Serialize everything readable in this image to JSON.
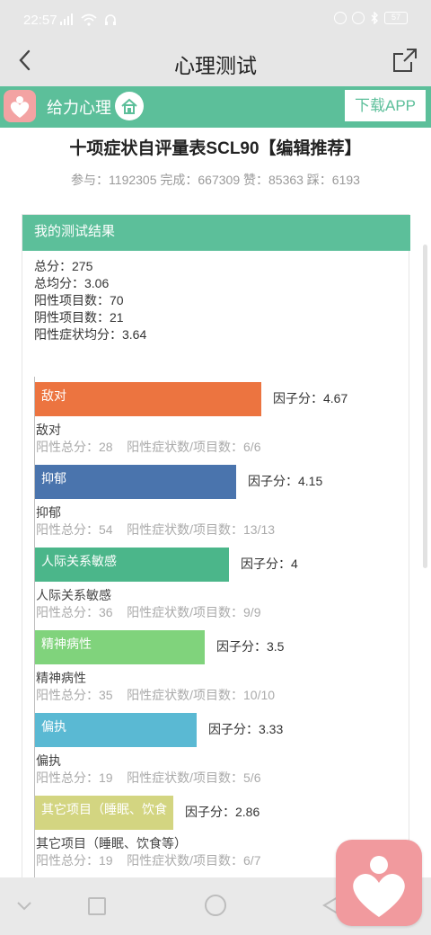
{
  "status_bar": {
    "time": "22:57",
    "battery": "57"
  },
  "header": {
    "title": "心理测试"
  },
  "app_banner": {
    "name": "给力心理",
    "download_label": "下载APP"
  },
  "test": {
    "title": "十项症状自评量表SCL90【编辑推荐】",
    "stats_line": "参与：1192305 完成：667309 赞：85363 踩：6193"
  },
  "result": {
    "header": "我的测试结果",
    "summary": [
      "总分：275",
      "总均分：3.06",
      "阳性项目数：70",
      "阴性项目数：21",
      "阳性症状均分：3.64"
    ]
  },
  "chart_data": {
    "type": "bar",
    "orientation": "horizontal",
    "categories": [
      "敌对",
      "抑郁",
      "人际关系敏感",
      "精神病性",
      "偏执",
      "其它项目（睡眠、饮食等）"
    ],
    "values": [
      4.67,
      4.15,
      4,
      3.5,
      3.33,
      2.86
    ],
    "value_prefix": "因子分：",
    "colors": [
      "#ec7440",
      "#4a74ad",
      "#4bb68a",
      "#80d37c",
      "#5ab9d3",
      "#d3d581"
    ],
    "xlim": [
      0,
      5
    ]
  },
  "factors": [
    {
      "bar_label": "敌对",
      "score_text": "因子分：4.67",
      "name": "敌对",
      "detail": "阳性总分：28    阳性症状数/项目数：6/6"
    },
    {
      "bar_label": "抑郁",
      "score_text": "因子分：4.15",
      "name": "抑郁",
      "detail": "阳性总分：54    阳性症状数/项目数：13/13"
    },
    {
      "bar_label": "人际关系敏感",
      "score_text": "因子分：4",
      "name": "人际关系敏感",
      "detail": "阳性总分：36    阳性症状数/项目数：9/9"
    },
    {
      "bar_label": "精神病性",
      "score_text": "因子分：3.5",
      "name": "精神病性",
      "detail": "阳性总分：35    阳性症状数/项目数：10/10"
    },
    {
      "bar_label": "偏执",
      "score_text": "因子分：3.33",
      "name": "偏执",
      "detail": "阳性总分：19    阳性症状数/项目数：5/6"
    },
    {
      "bar_label": "其它项目（睡眠、饮食",
      "score_text": "因子分：2.86",
      "name": "其它项目（睡眠、饮食等）",
      "detail": "阳性总分：19    阳性症状数/项目数：6/7"
    }
  ],
  "icons": {
    "back": "chevron-left-icon",
    "share": "share-icon",
    "home": "home-icon",
    "app_logo": "heart-person-icon"
  }
}
